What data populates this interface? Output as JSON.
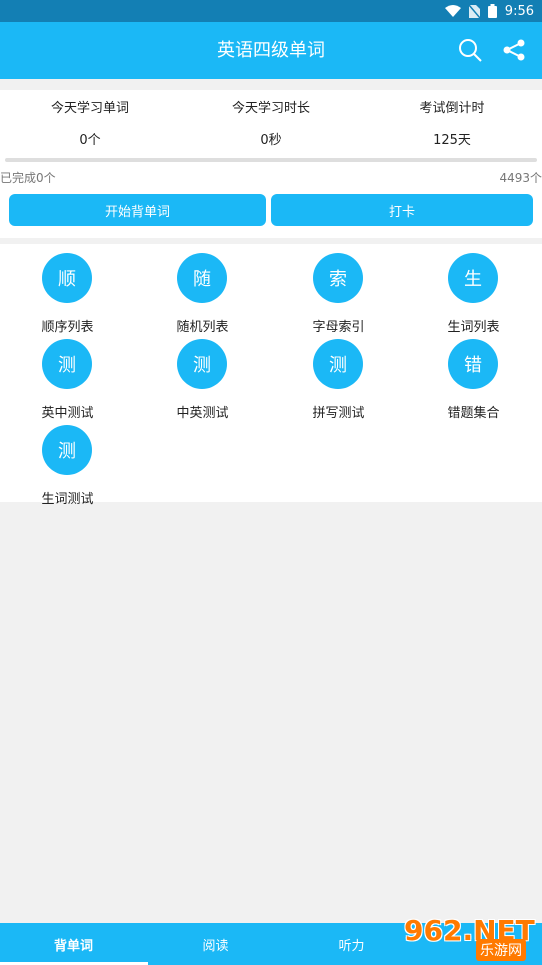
{
  "status_bar": {
    "time": "9:56"
  },
  "app_bar": {
    "title": "英语四级单词",
    "search_icon": "search-icon",
    "share_icon": "share-icon"
  },
  "stats": [
    {
      "label": "今天学习单词",
      "value": "0个"
    },
    {
      "label": "今天学习时长",
      "value": "0秒"
    },
    {
      "label": "考试倒计时",
      "value": "125天"
    }
  ],
  "progress": {
    "done_text": "已完成0个",
    "total_text": "4493个",
    "completed": 0,
    "total": 4493
  },
  "actions": {
    "start": "开始背单词",
    "checkin": "打卡"
  },
  "features": [
    {
      "glyph": "顺",
      "label": "顺序列表"
    },
    {
      "glyph": "随",
      "label": "随机列表"
    },
    {
      "glyph": "索",
      "label": "字母索引"
    },
    {
      "glyph": "生",
      "label": "生词列表"
    },
    {
      "glyph": "测",
      "label": "英中测试"
    },
    {
      "glyph": "测",
      "label": "中英测试"
    },
    {
      "glyph": "测",
      "label": "拼写测试"
    },
    {
      "glyph": "错",
      "label": "错题集合"
    },
    {
      "glyph": "测",
      "label": "生词测试"
    }
  ],
  "bottom_nav": [
    {
      "label": "背单词",
      "active": true
    },
    {
      "label": "阅读"
    },
    {
      "label": "听力"
    },
    {
      "label": ""
    }
  ],
  "watermark": {
    "num": "962.NET",
    "sub": "乐游网"
  },
  "colors": {
    "primary": "#1bb8f6",
    "status_bar": "#137fb4",
    "background": "#f1f1f1"
  }
}
